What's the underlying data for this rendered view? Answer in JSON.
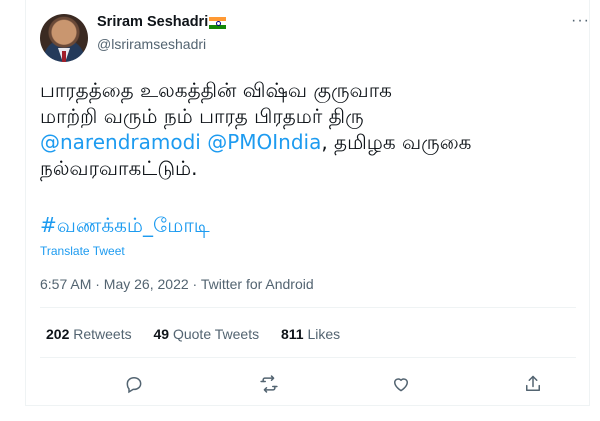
{
  "author": {
    "name": "Sriram Seshadri",
    "handle": "@lsriramseshadri",
    "flag": "india-flag"
  },
  "more_label": "···",
  "tweet": {
    "line1": "பாரதத்தை உலகத்தின் விஷ்வ குருவாக",
    "line2": "மாற்றி வரும் நம் பாரத பிரதமர் திரு",
    "mention1": "@narendramodi",
    "mention2": "@PMOIndia",
    "line3_rest": ", தமிழக வருகை",
    "line4": "நல்வரவாகட்டும்.",
    "hashtag": "#வணக்கம்_மோடி"
  },
  "translate_label": "Translate Tweet",
  "meta": "6:57 AM · May 26, 2022 · Twitter for Android",
  "stats": {
    "retweets_count": "202",
    "retweets_label": "Retweets",
    "quotes_count": "49",
    "quotes_label": "Quote Tweets",
    "likes_count": "811",
    "likes_label": "Likes"
  },
  "actions": [
    "reply-icon",
    "retweet-icon",
    "like-icon",
    "share-icon"
  ],
  "colors": {
    "link": "#1d9bf0",
    "muted": "#536471",
    "text": "#0f1419"
  }
}
